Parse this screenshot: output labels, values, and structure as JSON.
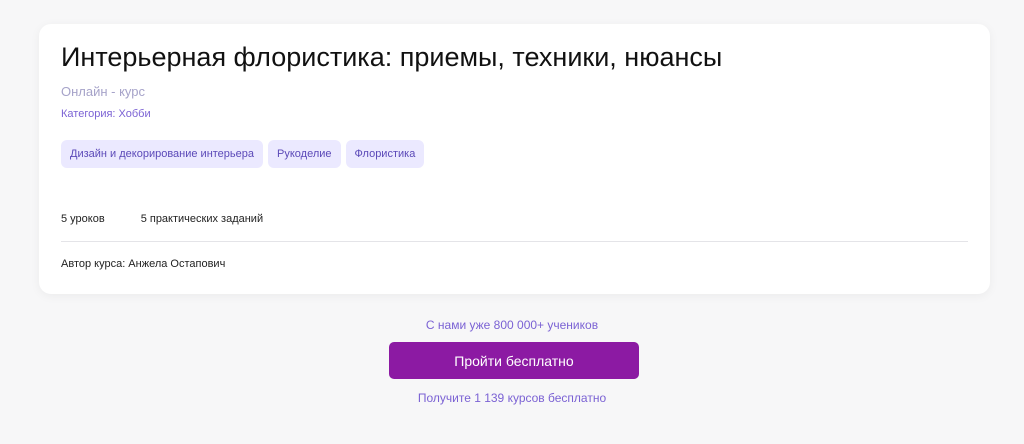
{
  "course": {
    "title": "Интерьерная флористика: приемы, техники, нюансы",
    "type": "Онлайн - курс",
    "category": "Категория: Хобби",
    "tags": [
      "Дизайн и декорирование интерьера",
      "Рукоделие",
      "Флористика"
    ],
    "lessons": "5 уроков",
    "tasks": "5 практических заданий",
    "author": "Автор курса: Анжела Остапович"
  },
  "cta": {
    "students": "С нами уже 800 000+ учеников",
    "button": "Пройти бесплатно",
    "free": "Получите 1 139 курсов бесплатно",
    "color": "#8c1aa3"
  }
}
